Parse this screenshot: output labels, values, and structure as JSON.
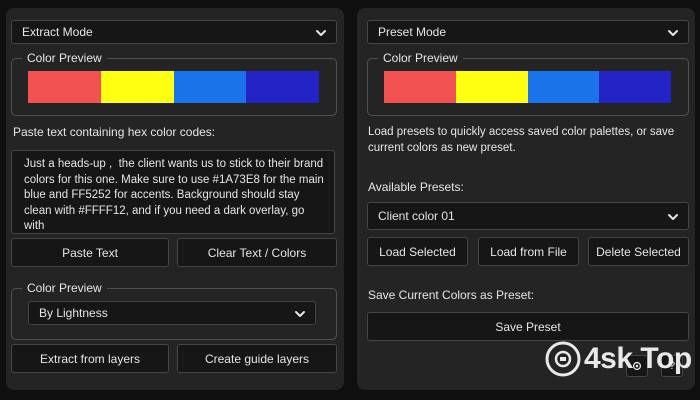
{
  "left": {
    "mode_dropdown": {
      "value": "Extract Mode"
    },
    "color_preview": {
      "title": "Color Preview",
      "swatches": [
        "#F25252",
        "#FFFF12",
        "#1A73E8",
        "#2323C6"
      ]
    },
    "paste_label": "Paste text containing hex color codes:",
    "text_input": {
      "value": "Just a heads-up ,  the client wants us to stick to their brand colors for this one. Make sure to use #1A73E8 for the main blue and FF5252 for accents. Background should stay clean with #FFFF12, and if you need a dark overlay, go with"
    },
    "buttons": {
      "paste": "Paste Text",
      "clear": "Clear Text / Colors",
      "extract": "Extract from layers",
      "guide": "Create guide layers"
    },
    "sort_group": {
      "title": "Color Preview",
      "dropdown_value": "By Lightness"
    }
  },
  "right": {
    "mode_dropdown": {
      "value": "Preset Mode"
    },
    "color_preview": {
      "title": "Color Preview",
      "swatches": [
        "#F25252",
        "#FFFF12",
        "#1A73E8",
        "#2323C6"
      ]
    },
    "description": "Load presets to quickly access saved color palettes, or save current colors as new preset.",
    "presets_label": "Available Presets:",
    "preset_dropdown": {
      "value": "Client color 01"
    },
    "buttons": {
      "load_selected": "Load Selected",
      "load_file": "Load from File",
      "delete_selected": "Delete Selected",
      "save_preset": "Save Preset"
    },
    "save_label": "Save Current Colors as Preset:",
    "corner_buttons": {
      "help": "?"
    }
  },
  "watermark": {
    "text": "4sk Top"
  },
  "colors": {
    "panel_bg": "#242424",
    "page_bg": "#0f0f0f",
    "control_bg": "#161616",
    "border": "#454545"
  }
}
